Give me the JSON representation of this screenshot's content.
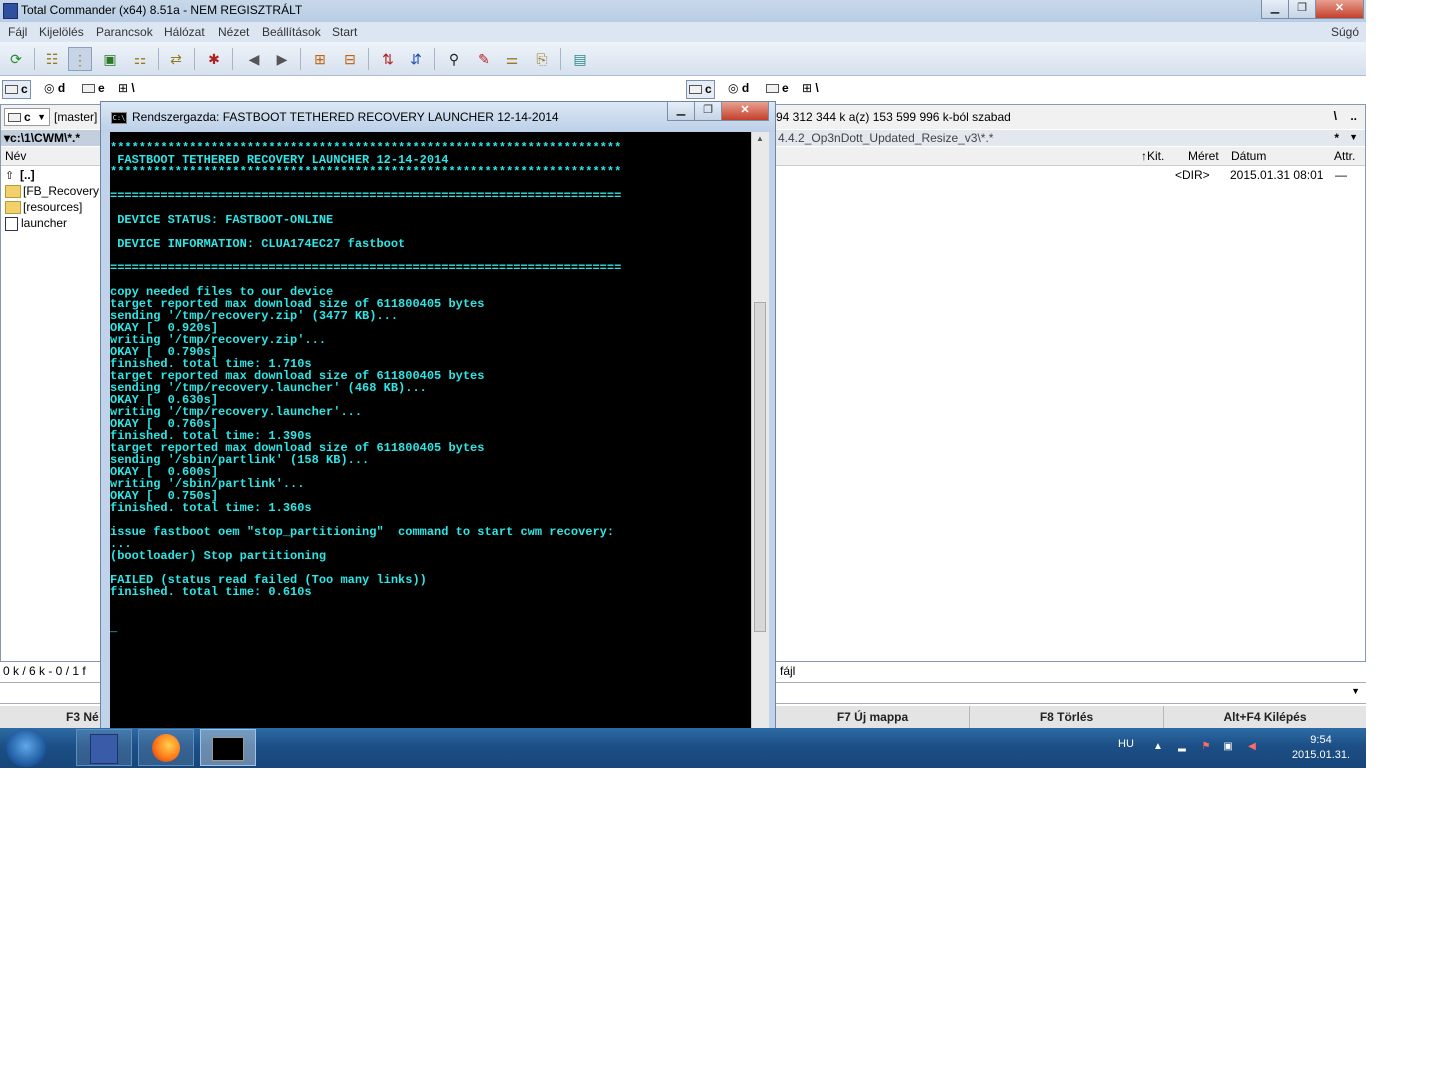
{
  "app": {
    "title": "Total Commander (x64) 8.51a - NEM REGISZTRÁLT",
    "window_buttons": {
      "minimize": "▁",
      "maximize": "❐",
      "close": "✕"
    }
  },
  "menu": {
    "items": [
      "Fájl",
      "Kijelölés",
      "Parancsok",
      "Hálózat",
      "Nézet",
      "Beállítások",
      "Start"
    ],
    "help": "Súgó"
  },
  "drives": {
    "left": {
      "c": "c",
      "d": "d",
      "e": "e",
      "net": "\\"
    },
    "right": {
      "c": "c",
      "d": "d",
      "e": "e",
      "net": "\\"
    }
  },
  "left_panel": {
    "drive_select": "c",
    "volume_label": "[master]",
    "path": "▾c:\\1\\CWM\\*.*",
    "col_name": "Név",
    "rows": [
      {
        "name": "[..]",
        "type": "up"
      },
      {
        "name": "[FB_Recovery",
        "type": "folder"
      },
      {
        "name": "[resources]",
        "type": "folder"
      },
      {
        "name": "launcher",
        "type": "file"
      }
    ],
    "status": "0 k / 6 k - 0 / 1 f"
  },
  "right_panel": {
    "free_space": "94 312 344 k a(z) 153 599 996 k-ból szabad",
    "root": "\\",
    "parent": "..",
    "path": "4.4.2_Op3nDott_Updated_Resize_v3\\*.*",
    "filter": "*",
    "cols": {
      "ext": "↑Kit.",
      "size": "Méret",
      "date": "Dátum",
      "attr": "Attr."
    },
    "rows": [
      {
        "size": "<DIR>",
        "date": "2015.01.31 08:01",
        "attr": "—"
      }
    ],
    "status": "fájl"
  },
  "fkeys": {
    "f3": "F3 Né",
    "f7": "F7 Új mappa",
    "f8": "F8 Törlés",
    "altf4": "Alt+F4 Kilépés"
  },
  "console": {
    "title": "Rendszergazda:  FASTBOOT TETHERED RECOVERY LAUNCHER 12-14-2014",
    "icon_text": "C:\\",
    "output": "***********************************************************************\n FASTBOOT TETHERED RECOVERY LAUNCHER 12-14-2014\n***********************************************************************\n\n=======================================================================\n\n DEVICE STATUS: FASTBOOT-ONLINE\n\n DEVICE INFORMATION: CLUA174EC27 fastboot\n\n=======================================================================\n\ncopy needed files to our device\ntarget reported max download size of 611800405 bytes\nsending '/tmp/recovery.zip' (3477 KB)...\nOKAY [  0.920s]\nwriting '/tmp/recovery.zip'...\nOKAY [  0.790s]\nfinished. total time: 1.710s\ntarget reported max download size of 611800405 bytes\nsending '/tmp/recovery.launcher' (468 KB)...\nOKAY [  0.630s]\nwriting '/tmp/recovery.launcher'...\nOKAY [  0.760s]\nfinished. total time: 1.390s\ntarget reported max download size of 611800405 bytes\nsending '/sbin/partlink' (158 KB)...\nOKAY [  0.600s]\nwriting '/sbin/partlink'...\nOKAY [  0.750s]\nfinished. total time: 1.360s\n\nissue fastboot oem \"stop_partitioning\"  command to start cwm recovery:\n...\n(bootloader) Stop partitioning\n\nFAILED (status read failed (Too many links))\nfinished. total time: 0.610s\n\n\n_"
  },
  "taskbar": {
    "lang": "HU",
    "time": "9:54",
    "date": "2015.01.31."
  },
  "colors": {
    "console_text": "#2ee6e6",
    "console_bg": "#000000",
    "taskbar": "#1c4f86",
    "title_bar": "#c8d8ea"
  }
}
